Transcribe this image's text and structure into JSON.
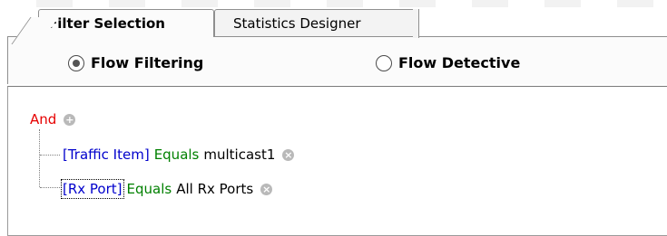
{
  "tabs": [
    {
      "label": "Filter Selection",
      "active": true
    },
    {
      "label": "Statistics Designer",
      "active": false
    }
  ],
  "mode": {
    "options": [
      {
        "label": "Flow Filtering",
        "selected": true
      },
      {
        "label": "Flow Detective",
        "selected": false
      }
    ]
  },
  "filter_tree": {
    "root": {
      "label": "And",
      "icon": "add-circle-icon"
    },
    "conditions": [
      {
        "field": "[Traffic Item]",
        "operator": "Equals",
        "value": "multicast1",
        "icon": "remove-circle-icon"
      },
      {
        "field": "[Rx Port]",
        "operator": "Equals",
        "value": "All Rx Ports",
        "icon": "remove-circle-icon"
      }
    ]
  },
  "colors": {
    "and": "#e60000",
    "field": "#0000cc",
    "operator": "#008000"
  }
}
